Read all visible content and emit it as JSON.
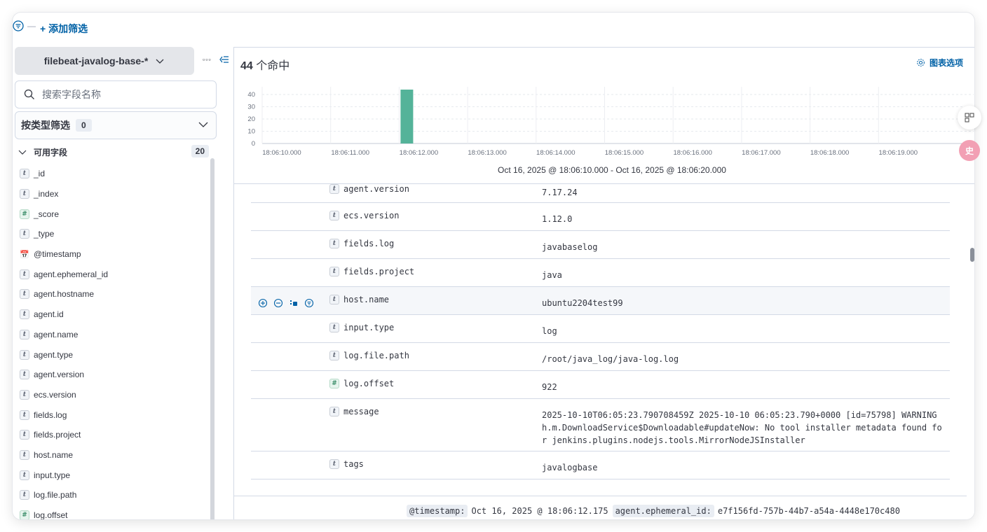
{
  "filterbar": {
    "add_filter_label": "+ 添加筛选"
  },
  "sidebar": {
    "index_pattern": "filebeat-javalog-base-*",
    "search_placeholder": "搜索字段名称",
    "type_filter_label": "按类型筛选",
    "type_filter_count": "0",
    "available_label": "可用字段",
    "available_count": "20",
    "fields": [
      {
        "type": "t",
        "name": "_id"
      },
      {
        "type": "t",
        "name": "_index"
      },
      {
        "type": "#",
        "name": "_score"
      },
      {
        "type": "t",
        "name": "_type"
      },
      {
        "type": "date",
        "name": "@timestamp"
      },
      {
        "type": "t",
        "name": "agent.ephemeral_id"
      },
      {
        "type": "t",
        "name": "agent.hostname"
      },
      {
        "type": "t",
        "name": "agent.id"
      },
      {
        "type": "t",
        "name": "agent.name"
      },
      {
        "type": "t",
        "name": "agent.type"
      },
      {
        "type": "t",
        "name": "agent.version"
      },
      {
        "type": "t",
        "name": "ecs.version"
      },
      {
        "type": "t",
        "name": "fields.log"
      },
      {
        "type": "t",
        "name": "fields.project"
      },
      {
        "type": "t",
        "name": "host.name"
      },
      {
        "type": "t",
        "name": "input.type"
      },
      {
        "type": "t",
        "name": "log.file.path"
      },
      {
        "type": "#",
        "name": "log.offset"
      }
    ]
  },
  "main": {
    "hits_count": "44",
    "hits_label": " 个命中",
    "chart_options_label": "图表选项",
    "time_range": "Oct 16, 2025 @ 18:06:10.000 - Oct 16, 2025 @ 18:06:20.000",
    "doc_rows": [
      {
        "type": "t",
        "field": "agent.version",
        "value": "7.17.24"
      },
      {
        "type": "t",
        "field": "ecs.version",
        "value": "1.12.0"
      },
      {
        "type": "t",
        "field": "fields.log",
        "value": "javabaselog"
      },
      {
        "type": "t",
        "field": "fields.project",
        "value": "java"
      },
      {
        "type": "t",
        "field": "host.name",
        "value": "ubuntu2204test99"
      },
      {
        "type": "t",
        "field": "input.type",
        "value": "log"
      },
      {
        "type": "t",
        "field": "log.file.path",
        "value": "/root/java_log/java-log.log"
      },
      {
        "type": "#",
        "field": "log.offset",
        "value": "922"
      },
      {
        "type": "t",
        "field": "message",
        "value": "2025-10-10T06:05:23.790708459Z 2025-10-10 06:05:23.790+0000 [id=75798]  WARNING h.m.DownloadService$Downloadable#updateNow: No tool installer metadata found for jenkins.plugins.nodejs.tools.MirrorNodeJSInstaller"
      },
      {
        "type": "t",
        "field": "tags",
        "value": "javalogbase"
      }
    ],
    "next_doc": {
      "timestamp_key": "@timestamp:",
      "timestamp_val": "Oct 16, 2025 @ 18:06:12.175",
      "ephemeral_key": "agent.ephemeral_id:",
      "ephemeral_val": "e7f156fd-757b-44b7-a54a-4448e170c480"
    }
  },
  "chart_data": {
    "type": "bar",
    "categories": [
      "18:06:10.000",
      "18:06:11.000",
      "18:06:12.000",
      "18:06:13.000",
      "18:06:14.000",
      "18:06:15.000",
      "18:06:16.000",
      "18:06:17.000",
      "18:06:18.000",
      "18:06:19.000"
    ],
    "values": [
      0,
      0,
      44,
      0,
      0,
      0,
      0,
      0,
      0,
      0
    ],
    "ylim": [
      0,
      44
    ],
    "yticks": [
      0,
      10,
      20,
      30,
      40
    ],
    "bar_color": "#54b399",
    "grid": true,
    "xlabel": "Oct 16, 2025 @ 18:06:10.000 - Oct 16, 2025 @ 18:06:20.000"
  },
  "floats": {
    "badge_text": "史"
  }
}
